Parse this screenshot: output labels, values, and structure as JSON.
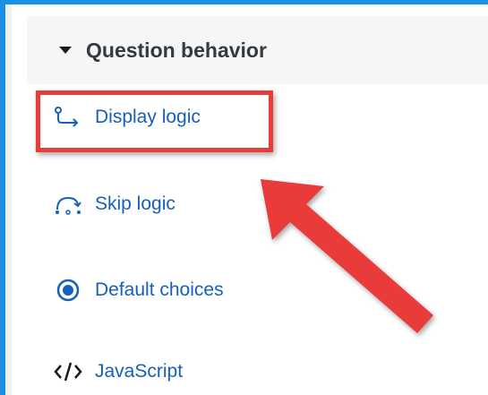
{
  "section": {
    "title": "Question behavior"
  },
  "items": [
    {
      "label": "Display logic",
      "icon": "display-logic-icon"
    },
    {
      "label": "Skip logic",
      "icon": "skip-logic-icon"
    },
    {
      "label": "Default choices",
      "icon": "radio-selected-icon"
    },
    {
      "label": "JavaScript",
      "icon": "code-icon"
    }
  ],
  "colors": {
    "accent": "#1560ba",
    "frame": "#1b8fe6",
    "highlight": "#ea3b3b"
  }
}
